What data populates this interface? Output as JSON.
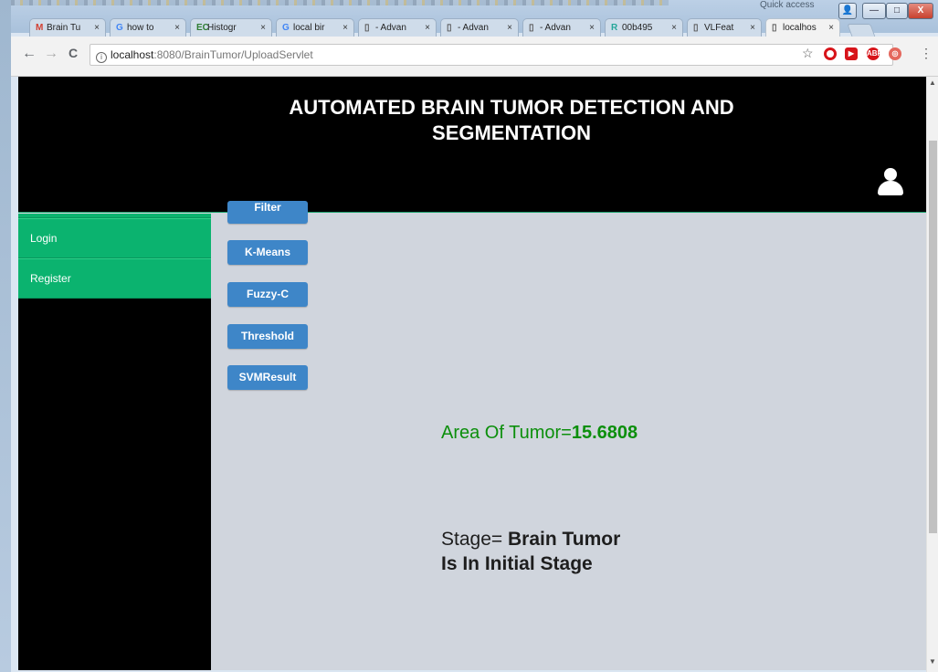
{
  "window": {
    "quick_access": "Quick access",
    "buttons": {
      "user": "👤",
      "minimize": "—",
      "maximize": "□",
      "close": "X"
    }
  },
  "tabs": [
    {
      "icon": "M",
      "icon_color": "#d23f31",
      "label": "Brain Tu",
      "active": false
    },
    {
      "icon": "G",
      "icon_color": "#4285f4",
      "label": "how to",
      "active": false
    },
    {
      "icon": "EC",
      "icon_color": "#2e7d32",
      "label": "Histogr",
      "active": false
    },
    {
      "icon": "G",
      "icon_color": "#4285f4",
      "label": "local bir",
      "active": false
    },
    {
      "icon": "page-icon",
      "label": "- Advan",
      "active": false
    },
    {
      "icon": "page-icon",
      "label": "- Advan",
      "active": false
    },
    {
      "icon": "page-icon",
      "label": "- Advan",
      "active": false
    },
    {
      "icon": "R",
      "icon_color": "#26a69a",
      "label": "00b495",
      "active": false
    },
    {
      "icon": "page-icon",
      "label": "VLFeat",
      "active": false
    },
    {
      "icon": "page-icon",
      "label": "localhos",
      "active": true
    }
  ],
  "toolbar": {
    "back": "←",
    "forward": "→",
    "reload": "C",
    "url_host": "localhost",
    "url_path": ":8080/BrainTumor/UploadServlet",
    "star": "☆",
    "menu": "⋮",
    "extensions": [
      "opera-icon",
      "video-icon",
      "adblock-icon",
      "extension-icon"
    ],
    "abp_label": "ABP"
  },
  "page": {
    "title": "AUTOMATED BRAIN TUMOR DETECTION AND SEGMENTATION",
    "sidebar": [
      {
        "label": "Login"
      },
      {
        "label": "Register"
      }
    ],
    "buttons": {
      "filter": "Filter",
      "kmeans": "K-Means",
      "fuzzy": "Fuzzy-C",
      "threshold": "Threshold",
      "svm": "SVMResult"
    },
    "area_label": "Area Of Tumor=",
    "area_value": "15.6808",
    "stage_label": "Stage= ",
    "stage_value": "Brain Tumor Is In Initial Stage",
    "colors": {
      "header_bg": "#000000",
      "sidebar_accent": "#0bb36f",
      "button_blue": "#3e86c8",
      "area_green": "#0c8f0c",
      "content_bg": "#d0d5dd"
    }
  }
}
